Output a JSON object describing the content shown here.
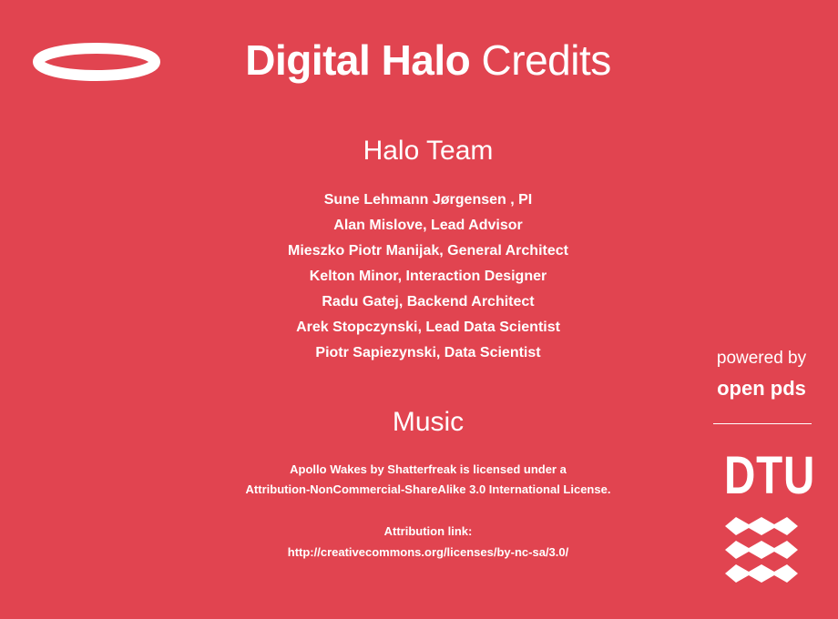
{
  "header": {
    "title_bold": "Digital Halo",
    "title_light": "Credits",
    "logo_icon": "halo-ring-icon"
  },
  "team": {
    "heading": "Halo Team",
    "members": [
      "Sune Lehmann Jørgensen , PI",
      "Alan Mislove, Lead Advisor",
      "Mieszko Piotr Manijak, General Architect",
      "Kelton Minor, Interaction Designer",
      "Radu Gatej, Backend Architect",
      "Arek Stopczynski, Lead Data Scientist",
      "Piotr Sapiezynski, Data Scientist"
    ]
  },
  "music": {
    "heading": "Music",
    "line1": "Apollo Wakes by Shatterfreak is licensed under a",
    "line2": "Attribution-NonCommercial-ShareAlike 3.0 International License.",
    "attribution_label": "Attribution link:",
    "attribution_link": "http://creativecommons.org/licenses/by-nc-sa/3.0/"
  },
  "sidebar": {
    "powered_by": "powered by",
    "product": "open pds",
    "institution": "DTU",
    "institution_icon": "dtu-waves-icon"
  },
  "colors": {
    "background": "#e14450",
    "foreground": "#ffffff"
  }
}
